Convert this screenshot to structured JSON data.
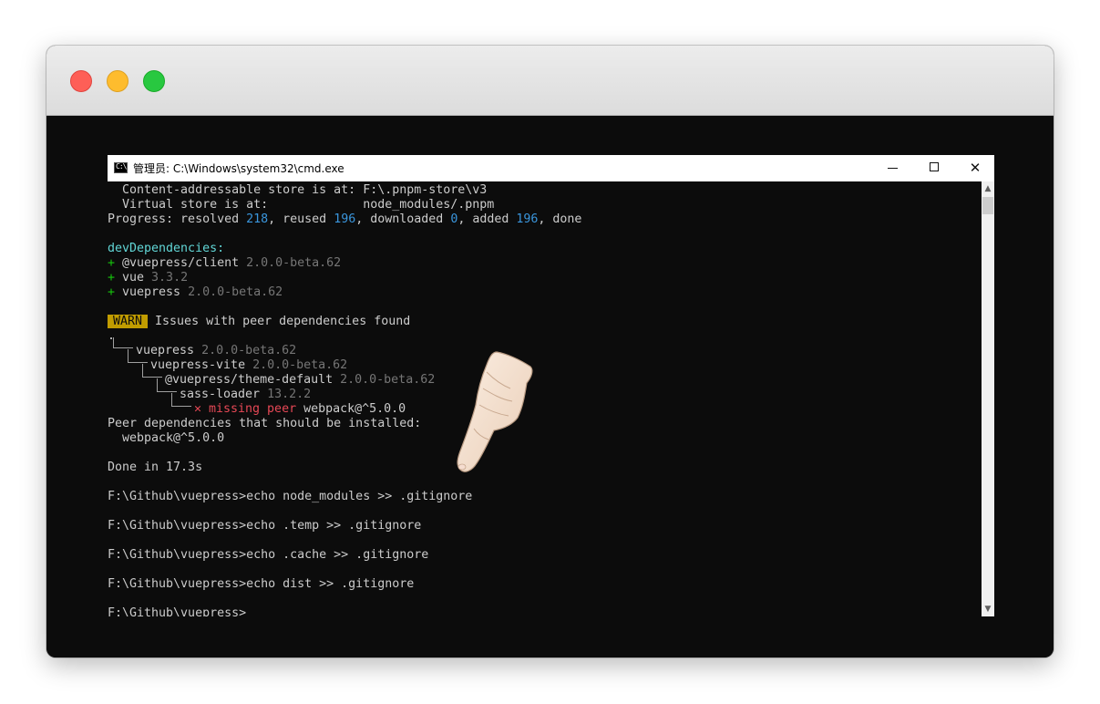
{
  "cmd": {
    "title": "管理员: C:\\Windows\\system32\\cmd.exe",
    "min_glyph": "",
    "close_glyph": "✕"
  },
  "console": {
    "store_line": "  Content-addressable store is at: F:\\.pnpm-store\\v3",
    "virtual_line": "  Virtual store is at:             node_modules/.pnpm",
    "progress": {
      "p1": "Progress: resolved ",
      "resolved": "218",
      "p2": ", reused ",
      "reused": "196",
      "p3": ", downloaded ",
      "downloaded": "0",
      "p4": ", added ",
      "added": "196",
      "p5": ", done"
    },
    "dev_deps_header": "devDependencies:",
    "dev_deps": [
      {
        "plus": "+ ",
        "name": "@vuepress/client ",
        "version": "2.0.0-beta.62"
      },
      {
        "plus": "+ ",
        "name": "vue ",
        "version": "3.3.2"
      },
      {
        "plus": "+ ",
        "name": "vuepress ",
        "version": "2.0.0-beta.62"
      }
    ],
    "warn_badge": "WARN",
    "warn_text": " Issues with peer dependencies found",
    "tree_root": ".",
    "tree": [
      {
        "name": "vuepress ",
        "version": "2.0.0-beta.62"
      },
      {
        "name": "vuepress-vite ",
        "version": "2.0.0-beta.62"
      },
      {
        "name": "@vuepress/theme-default ",
        "version": "2.0.0-beta.62"
      },
      {
        "name": "sass-loader ",
        "version": "13.2.2"
      }
    ],
    "missing": {
      "mark": "✕ missing peer ",
      "pkg": "webpack@^5.0.0"
    },
    "peer_header": "Peer dependencies that should be installed:",
    "peer_item": "  webpack@^5.0.0",
    "done": "Done in 17.3s",
    "commands": [
      "F:\\Github\\vuepress>echo node_modules >> .gitignore",
      "F:\\Github\\vuepress>echo .temp >> .gitignore",
      "F:\\Github\\vuepress>echo .cache >> .gitignore",
      "F:\\Github\\vuepress>echo dist >> .gitignore"
    ],
    "prompt": "F:\\Github\\vuepress>_"
  },
  "icons": {
    "app": "cmd-app-icon",
    "pointer": "pointing-hand-icon"
  }
}
